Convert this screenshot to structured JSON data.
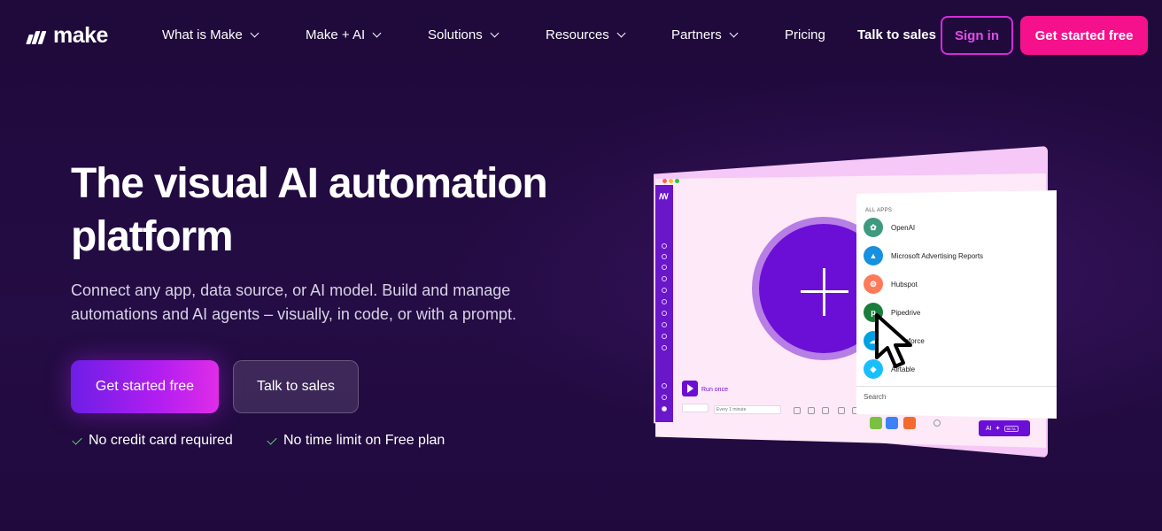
{
  "brand": {
    "name": "make",
    "accent": "#f5108c",
    "signin_color": "#d42bd8",
    "background": "#200a3f"
  },
  "nav": {
    "items": [
      {
        "label": "What is Make",
        "has_dropdown": true
      },
      {
        "label": "Make + AI",
        "has_dropdown": true
      },
      {
        "label": "Solutions",
        "has_dropdown": true
      },
      {
        "label": "Resources",
        "has_dropdown": true
      },
      {
        "label": "Partners",
        "has_dropdown": true
      },
      {
        "label": "Pricing",
        "has_dropdown": false
      }
    ],
    "talk_to_sales": "Talk to sales",
    "sign_in": "Sign in",
    "get_started": "Get started free"
  },
  "hero": {
    "title": "The visual AI automation platform",
    "subtitle": "Connect any app, data source, or AI model. Build and manage automations and AI agents – visually, in code, or with a prompt.",
    "primary_cta": "Get started free",
    "secondary_cta": "Talk to sales",
    "checks": [
      "No credit card required",
      "No time limit on Free plan"
    ]
  },
  "mockup": {
    "panel_heading": "ALL APPS",
    "apps": [
      {
        "name": "OpenAI",
        "color": "#3d9a7f",
        "glyph": "✿"
      },
      {
        "name": "Microsoft Advertising Reports",
        "color": "#1690e0",
        "glyph": "▲"
      },
      {
        "name": "Hubspot",
        "color": "#ff7a59",
        "glyph": "⚙"
      },
      {
        "name": "Pipedrive",
        "color": "#1b7d3d",
        "glyph": "p"
      },
      {
        "name": "Salesforce",
        "color": "#00a1e0",
        "glyph": "☁"
      },
      {
        "name": "Airtable",
        "color": "#18bfff",
        "glyph": "◆"
      }
    ],
    "search_label": "Search",
    "run_once": "Run once",
    "schedule": "Every 1 minute",
    "ai_label": "AI",
    "beta_label": "BETA"
  }
}
